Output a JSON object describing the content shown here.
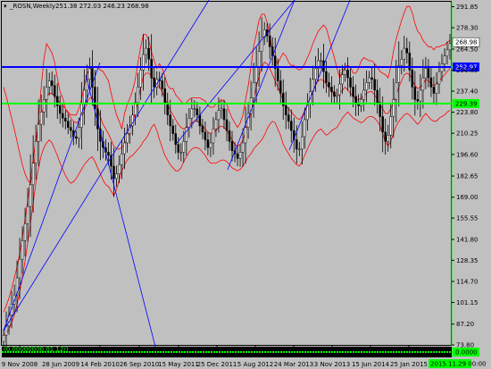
{
  "colors": {
    "background": "#c0c0c0",
    "candles": "#000000",
    "bands": "#ff0000",
    "trendlines": "#0000ff",
    "level_blue": "#0000ff",
    "level_green": "#00ff00",
    "indicator_bg": "#000000",
    "indicator_line": "#00ff00"
  },
  "header": {
    "symbol": "_ROSN,Weekly",
    "ohlc": "251.38 272.03 246.23 268.98"
  },
  "indicator": {
    "label": "(0.00000000,01.12/)",
    "value_tag": "0.0000"
  },
  "chart_data": {
    "type": "candlestick",
    "y_ticks": [
      "291.85",
      "278.30",
      "264.50",
      "250.85",
      "237.40",
      "223.80",
      "210.25",
      "196.60",
      "182.65",
      "169.00",
      "155.55",
      "141.80",
      "128.35",
      "114.70",
      "101.15",
      "87.20",
      "73.80"
    ],
    "ylim": [
      73.8,
      295
    ],
    "x_ticks": [
      "9 Nov 2008",
      "28 Jun 2009",
      "14 Feb 2010",
      "26 Sep 2010",
      "15 May 2011",
      "25 Dec 2011",
      "5 Aug 2012",
      "24 Mar 2013",
      "3 Nov 2013",
      "15 Jun 2014",
      "25 Jan 2015"
    ],
    "last_price": "268.98",
    "levels": [
      {
        "value": 252.97,
        "label": "252.97",
        "color": "#0000ff"
      },
      {
        "value": 229.39,
        "label": "229.39",
        "color": "#00ff00"
      }
    ],
    "cursor_date": "2015.11.29 00:00",
    "series": [
      {
        "name": "price",
        "values": [
          80,
          86,
          93,
          100,
          106,
          117,
          129,
          141,
          152,
          163,
          177,
          191,
          205,
          216,
          224,
          232,
          240,
          244,
          241,
          234,
          228,
          223,
          220,
          218,
          214,
          212,
          208,
          207,
          214,
          229,
          238,
          245,
          252,
          240,
          226,
          213,
          205,
          201,
          198,
          196,
          189,
          181,
          184,
          190,
          197,
          204,
          210,
          215,
          222,
          230,
          240,
          251,
          261,
          265,
          258,
          246,
          240,
          245,
          244,
          239,
          230,
          222,
          215,
          210,
          203,
          198,
          198,
          205,
          214,
          220,
          226,
          226,
          222,
          215,
          211,
          206,
          201,
          204,
          213,
          219,
          225,
          226,
          219,
          212,
          205,
          199,
          197,
          194,
          198,
          204,
          214,
          223,
          233,
          243,
          253,
          263,
          272,
          277,
          273,
          266,
          260,
          252,
          244,
          236,
          228,
          222,
          218,
          212,
          206,
          200,
          200,
          208,
          219,
          229,
          237,
          245,
          252,
          257,
          257,
          250,
          243,
          240,
          237,
          234,
          235,
          242,
          248,
          251,
          246,
          240,
          234,
          229,
          228,
          232,
          238,
          243,
          246,
          245,
          238,
          230,
          221,
          211,
          205,
          209,
          221,
          232,
          243,
          254,
          258,
          265,
          262,
          251,
          240,
          232,
          231,
          238,
          246,
          252,
          246,
          240,
          236,
          242,
          250,
          255,
          260,
          264,
          268
        ]
      },
      {
        "name": "upper",
        "values": [
          240,
          234,
          227,
          220,
          213,
          205,
          197,
          190,
          184,
          180,
          178,
          185,
          200,
          220,
          240,
          258,
          268,
          265,
          262,
          256,
          246,
          237,
          233,
          226,
          224,
          222,
          222,
          222,
          226,
          232,
          241,
          248,
          252,
          253,
          253,
          253,
          251,
          250,
          247,
          244,
          236,
          229,
          222,
          218,
          213,
          223,
          229,
          233,
          238,
          245,
          256,
          266,
          274,
          274,
          270,
          263,
          257,
          252,
          255,
          252,
          247,
          241,
          239,
          239,
          235,
          233,
          231,
          229,
          230,
          232,
          233,
          233,
          233,
          233,
          232,
          231,
          228,
          227,
          227,
          229,
          230,
          232,
          231,
          229,
          224,
          220,
          217,
          214,
          217,
          222,
          232,
          241,
          253,
          266,
          274,
          283,
          287,
          287,
          282,
          274,
          263,
          258,
          255,
          259,
          262,
          260,
          256,
          254,
          254,
          252,
          251,
          252,
          255,
          259,
          263,
          268,
          272,
          276,
          278,
          280,
          278,
          272,
          265,
          259,
          252,
          246,
          250,
          253,
          254,
          253,
          249,
          249,
          252,
          257,
          259,
          258,
          257,
          257,
          255,
          253,
          250,
          249,
          248,
          246,
          253,
          263,
          271,
          277,
          283,
          288,
          292,
          292,
          288,
          281,
          276,
          274,
          270,
          268,
          266,
          266,
          264,
          266,
          266,
          267,
          267,
          269,
          270
        ]
      },
      {
        "name": "middle",
        "values": [
          95,
          99,
          104,
          110,
          117,
          124,
          133,
          143,
          155,
          167,
          180,
          193,
          206,
          215,
          222,
          228,
          234,
          236,
          236,
          234,
          232,
          230,
          228,
          226,
          223,
          220,
          218,
          217,
          218,
          220,
          225,
          230,
          233,
          233,
          230,
          226,
          221,
          216,
          213,
          210,
          206,
          202,
          200,
          200,
          201,
          203,
          207,
          212,
          217,
          224,
          232,
          240,
          247,
          249,
          249,
          247,
          244,
          242,
          240,
          237,
          233,
          229,
          225,
          222,
          219,
          216,
          214,
          213,
          214,
          215,
          217,
          218,
          218,
          217,
          215,
          213,
          211,
          210,
          211,
          212,
          214,
          215,
          214,
          212,
          209,
          206,
          203,
          202,
          203,
          206,
          211,
          217,
          224,
          232,
          240,
          247,
          253,
          256,
          255,
          252,
          248,
          244,
          240,
          236,
          231,
          228,
          226,
          224,
          222,
          220,
          219,
          221,
          225,
          229,
          233,
          237,
          241,
          244,
          245,
          244,
          242,
          240,
          237,
          235,
          234,
          236,
          238,
          240,
          238,
          236,
          234,
          232,
          232,
          233,
          234,
          236,
          237,
          237,
          235,
          232,
          229,
          226,
          223,
          223,
          226,
          230,
          235,
          240,
          244,
          248,
          249,
          248,
          245,
          241,
          239,
          240,
          242,
          245,
          244,
          242,
          241,
          242,
          244,
          246,
          248,
          250,
          252
        ]
      },
      {
        "name": "lower",
        "values": [
          80,
          81,
          84,
          88,
          93,
          100,
          108,
          117,
          128,
          140,
          152,
          165,
          178,
          188,
          196,
          201,
          204,
          206,
          204,
          200,
          196,
          191,
          187,
          183,
          180,
          178,
          179,
          181,
          184,
          187,
          190,
          192,
          194,
          195,
          192,
          188,
          184,
          180,
          177,
          176,
          173,
          170,
          174,
          180,
          186,
          190,
          193,
          195,
          196,
          198,
          200,
          202,
          205,
          207,
          210,
          214,
          216,
          212,
          206,
          201,
          196,
          193,
          190,
          188,
          186,
          186,
          188,
          192,
          195,
          198,
          200,
          201,
          201,
          200,
          198,
          196,
          193,
          191,
          191,
          191,
          192,
          193,
          193,
          192,
          190,
          188,
          187,
          186,
          187,
          189,
          192,
          195,
          197,
          200,
          202,
          204,
          206,
          209,
          213,
          216,
          218,
          217,
          213,
          209,
          203,
          200,
          197,
          194,
          192,
          190,
          189,
          192,
          196,
          200,
          204,
          207,
          210,
          212,
          213,
          211,
          209,
          210,
          212,
          213,
          214,
          217,
          220,
          222,
          224,
          222,
          220,
          219,
          218,
          217,
          218,
          220,
          221,
          221,
          220,
          218,
          215,
          210,
          205,
          202,
          205,
          210,
          215,
          218,
          220,
          222,
          223,
          222,
          220,
          218,
          216,
          218,
          221,
          223,
          221,
          219,
          218,
          218,
          220,
          221,
          222,
          224,
          225
        ]
      }
    ]
  }
}
